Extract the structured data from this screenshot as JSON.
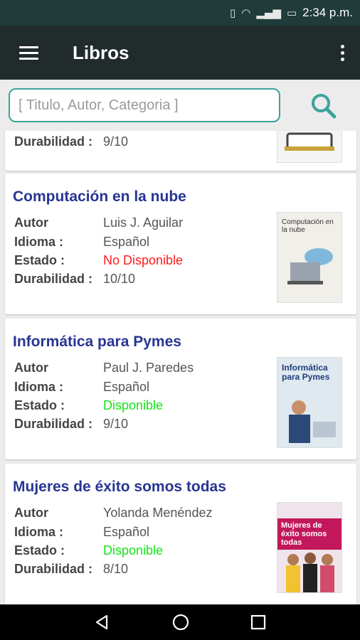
{
  "status_bar": {
    "time": "2:34 p.m."
  },
  "app_bar": {
    "title": "Libros"
  },
  "search": {
    "placeholder": "[ Titulo, Autor, Categoria ]"
  },
  "labels": {
    "author": "Autor",
    "language": "Idioma :",
    "status": "Estado :",
    "durability": "Durabilidad :"
  },
  "colors": {
    "accent": "#3aa49b",
    "title": "#283593",
    "available": "#17e317",
    "unavailable": "#ff1a1a"
  },
  "books": [
    {
      "title": "",
      "author": "",
      "language": "",
      "status": "",
      "durability": "9/10"
    },
    {
      "title": "Computación en la nube",
      "author": "Luis J. Aguilar",
      "language": "Español",
      "status": "No Disponible",
      "available": false,
      "durability": "10/10",
      "cover_text": "Computación en la nube"
    },
    {
      "title": "Informática para Pymes",
      "author": "Paul J. Paredes",
      "language": "Español",
      "status": "Disponible",
      "available": true,
      "durability": "9/10",
      "cover_text": "Informática para Pymes"
    },
    {
      "title": "Mujeres de éxito somos todas",
      "author": "Yolanda Menéndez",
      "language": "Español",
      "status": "Disponible",
      "available": true,
      "durability": "8/10",
      "cover_text": "Mujeres de éxito somos todas"
    }
  ]
}
